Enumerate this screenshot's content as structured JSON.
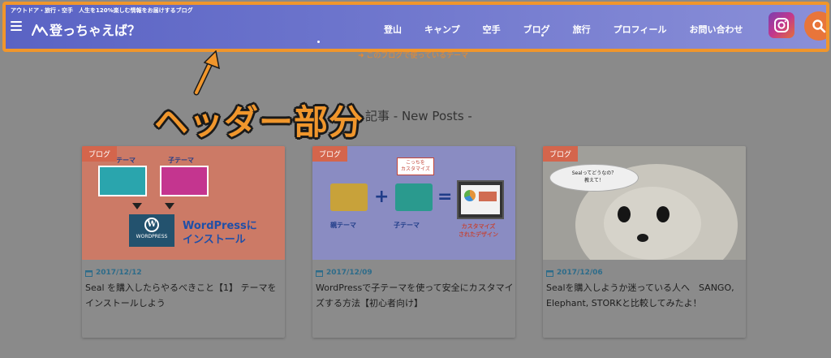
{
  "header": {
    "tagline": "アウトドア・旅行・空手　人生を120%楽しむ情報をお届けするブログ",
    "logo_text": "登っちゃえば？",
    "nav": [
      "登山",
      "キャンプ",
      "空手",
      "ブログ",
      "旅行",
      "プロフィール",
      "お問い合わせ"
    ]
  },
  "theme_link": "➜ このブログで使っているテーマ",
  "section_title": "記事 - New Posts -",
  "annotation": "ヘッダー部分",
  "cards": [
    {
      "badge": "ブログ",
      "date": "2017/12/12",
      "title": "Seal を購入したらやるべきこと【1】 テーマをインストールしよう",
      "thumb": {
        "parent_label": "テーマ",
        "child_label": "子テーマ",
        "wp_logo": "W",
        "wp_text": "WORDPRESS",
        "headline": "WordPressに\nインストール"
      }
    },
    {
      "badge": "ブログ",
      "date": "2017/12/09",
      "title": "WordPressで子テーマを使って安全にカスタマイズする方法【初心者向け】",
      "thumb": {
        "parent_label": "親テーマ",
        "child_label": "子テーマ",
        "bubble": "こっちを\nカスタマイズ",
        "plus": "+",
        "equals": "=",
        "design_label": "カスタマイズ\nされたデザイン"
      }
    },
    {
      "badge": "ブログ",
      "date": "2017/12/06",
      "title": "Sealを購入しようか迷っている人へ　SANGO, Elephant, STORKと比較してみたよ！",
      "thumb": {
        "cloud_text": "Sealってどうなの？\n教えて！"
      }
    }
  ],
  "colors": {
    "header_start": "#5a63c4",
    "header_end": "#8a8fd8",
    "annotation": "#f0962c",
    "badge": "#d4654c",
    "date": "#2d6c8a",
    "search": "#e8753a"
  },
  "icons": [
    "menu-icon",
    "logo-mountain-icon",
    "instagram-icon",
    "search-icon",
    "calendar-icon",
    "arrow-pointer-icon"
  ]
}
